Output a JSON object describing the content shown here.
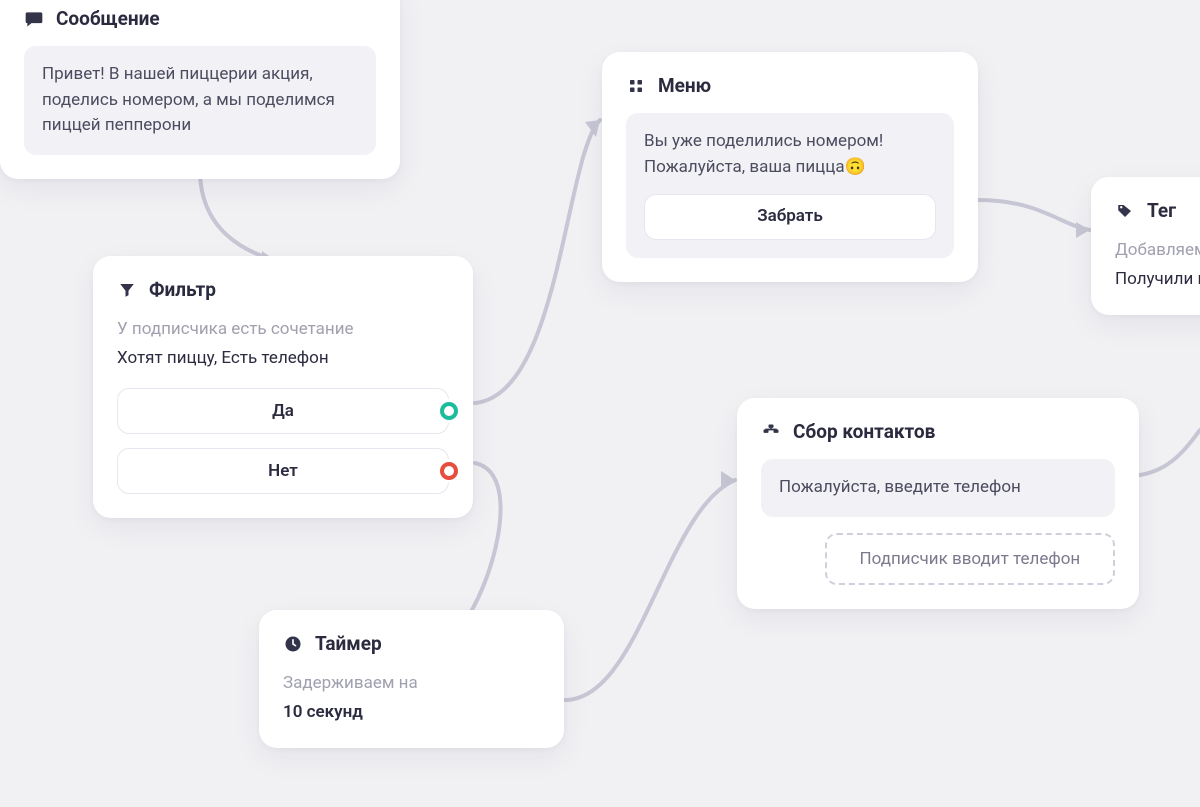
{
  "message": {
    "title": "Сообщение",
    "text": "Привет! В нашей пиццерии акция, поделись номером, а мы поделимся пиццей пепперони"
  },
  "filter": {
    "title": "Фильтр",
    "subtitle": "У подписчика есть сочетание",
    "condition": "Хотят пиццу, Есть телефон",
    "yes": "Да",
    "no": "Нет"
  },
  "timer": {
    "title": "Таймер",
    "subtitle": "Задерживаем на",
    "value": "10 секунд"
  },
  "menu": {
    "title": "Меню",
    "text": "Вы уже поделились номером! Пожалуйста, ваша пицца🙃",
    "button": "Забрать"
  },
  "tag": {
    "title": "Тег",
    "subtitle": "Добавляем",
    "value": "Получили пи"
  },
  "contacts": {
    "title": "Сбор контактов",
    "prompt": "Пожалуйста, введите телефон",
    "input": "Подписчик вводит телефон"
  }
}
